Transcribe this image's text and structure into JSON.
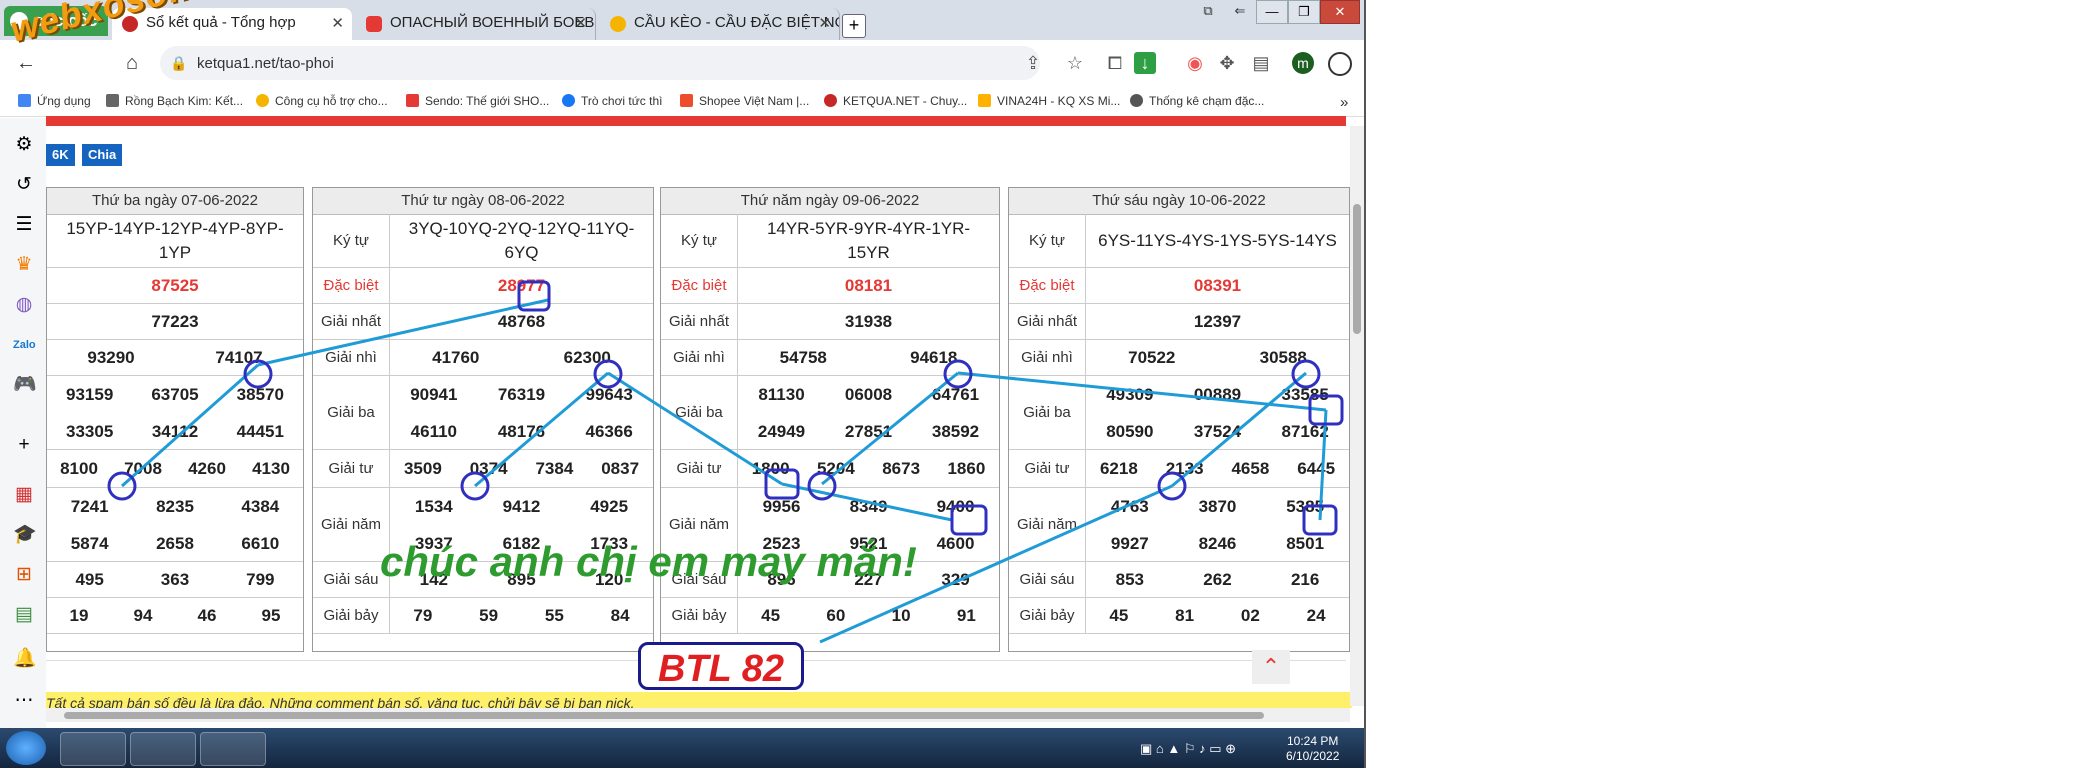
{
  "browser": {
    "brand": "cốc cốc",
    "tabs": [
      {
        "title": "Sổ kết quả - Tổng hợp"
      },
      {
        "title": "ОПАСНЫЙ ВОЕННЫЙ БОЕВ"
      },
      {
        "title": "CẦU KÈO - CẦU ĐẶC BIỆT NO"
      }
    ],
    "new_tab": "+",
    "url": "ketqua1.net/tao-phoi",
    "profile_initial": "m",
    "window_controls": [
      "—",
      "❐",
      "✕"
    ]
  },
  "bookmarks": [
    {
      "label": "Ứng dụng",
      "color": "#4285f4"
    },
    {
      "label": "Rồng Bạch Kim: Kết...",
      "color": "#666666"
    },
    {
      "label": "Công cụ hỗ trợ cho...",
      "color": "#f4b400"
    },
    {
      "label": "Sendo: Thế giới SHO...",
      "color": "#e53935"
    },
    {
      "label": "Trò chơi tức thì",
      "color": "#1877f2"
    },
    {
      "label": "Shopee Việt Nam |...",
      "color": "#ee4d2d"
    },
    {
      "label": "KETQUA.NET - Chuy...",
      "color": "#c62828"
    },
    {
      "label": "VINA24H - KQ XS Mi...",
      "color": "#ffb300"
    },
    {
      "label": "Thống kê chạm đặc...",
      "color": "#555555"
    }
  ],
  "bookmarks_more": "»",
  "page": {
    "buttons": [
      "6K",
      "Chia"
    ],
    "panels": [
      {
        "date": "Thứ ba ngày 07-06-2022",
        "code": "15YP-14YP-12YP-4YP-8YP-1YP",
        "dac_biet": "87525",
        "nhat": "77223",
        "nhi": [
          "93290",
          "74107"
        ],
        "ba": [
          "93159",
          "63705",
          "38570",
          "33305",
          "34112",
          "44451"
        ],
        "tu": [
          "8100",
          "7008",
          "4260",
          "4130"
        ],
        "nam": [
          "7241",
          "8235",
          "4384",
          "5874",
          "2658",
          "6610"
        ],
        "sau": [
          "495",
          "363",
          "799"
        ],
        "bay": [
          "19",
          "94",
          "46",
          "95"
        ]
      },
      {
        "date": "Thứ tư ngày 08-06-2022",
        "code_label": "Ký tự",
        "code": "3YQ-10YQ-2YQ-12YQ-11YQ-6YQ",
        "dac_biet_label": "Đặc biệt",
        "dac_biet": "28977",
        "nhat_label": "Giải nhất",
        "nhat": "48768",
        "nhi_label": "Giải nhì",
        "nhi": [
          "41760",
          "62300"
        ],
        "ba_label": "Giải ba",
        "ba": [
          "90941",
          "76319",
          "99643",
          "46110",
          "48176",
          "46366"
        ],
        "tu_label": "Giải tư",
        "tu": [
          "3509",
          "0374",
          "7384",
          "0837"
        ],
        "nam_label": "Giải năm",
        "nam": [
          "1534",
          "9412",
          "4925",
          "3937",
          "6182",
          "1733"
        ],
        "sau_label": "Giải sáu",
        "sau": [
          "142",
          "895",
          "120"
        ],
        "bay_label": "Giải bảy",
        "bay": [
          "79",
          "59",
          "55",
          "84"
        ]
      },
      {
        "date": "Thứ năm ngày 09-06-2022",
        "code_label": "Ký tự",
        "code": "14YR-5YR-9YR-4YR-1YR-15YR",
        "dac_biet_label": "Đặc biệt",
        "dac_biet": "08181",
        "nhat_label": "Giải nhất",
        "nhat": "31938",
        "nhi_label": "Giải nhì",
        "nhi": [
          "54758",
          "94618"
        ],
        "ba_label": "Giải ba",
        "ba": [
          "81130",
          "06008",
          "64761",
          "24949",
          "27851",
          "38592"
        ],
        "tu_label": "Giải tư",
        "tu": [
          "1800",
          "5204",
          "8673",
          "1860"
        ],
        "nam_label": "Giải năm",
        "nam": [
          "9956",
          "8349",
          "9400",
          "2523",
          "9521",
          "4600"
        ],
        "sau_label": "Giải sáu",
        "sau": [
          "896",
          "227",
          "329"
        ],
        "bay_label": "Giải bảy",
        "bay": [
          "45",
          "60",
          "10",
          "91"
        ]
      },
      {
        "date": "Thứ sáu ngày 10-06-2022",
        "code_label": "Ký tự",
        "code": "6YS-11YS-4YS-1YS-5YS-14YS",
        "dac_biet_label": "Đặc biệt",
        "dac_biet": "08391",
        "nhat_label": "Giải nhất",
        "nhat": "12397",
        "nhi_label": "Giải nhì",
        "nhi": [
          "70522",
          "30588"
        ],
        "ba_label": "Giải ba",
        "ba": [
          "49309",
          "00889",
          "33585",
          "80590",
          "37524",
          "87162"
        ],
        "tu_label": "Giải tư",
        "tu": [
          "6218",
          "2133",
          "4658",
          "6445"
        ],
        "nam_label": "Giải năm",
        "nam": [
          "4763",
          "3870",
          "5385",
          "9927",
          "8246",
          "8501"
        ],
        "sau_label": "Giải sáu",
        "sau": [
          "853",
          "262",
          "216"
        ],
        "bay_label": "Giải bảy",
        "bay": [
          "45",
          "81",
          "02",
          "24"
        ]
      }
    ],
    "notice": "Tất cả spam bán số đều là lừa đảo. Những comment bán số, văng tục, chửi bậy sẽ bị ban nick.",
    "scroll_top": "^"
  },
  "overlay": {
    "watermark": "webxoso.net",
    "greeting": "chúc anh chị em may mắn!",
    "result": "BTL 82",
    "line_color": "#1f9bd8",
    "circle_color": "#3030c0"
  },
  "taskbar": {
    "time": "10:24 PM",
    "date": "6/10/2022"
  }
}
